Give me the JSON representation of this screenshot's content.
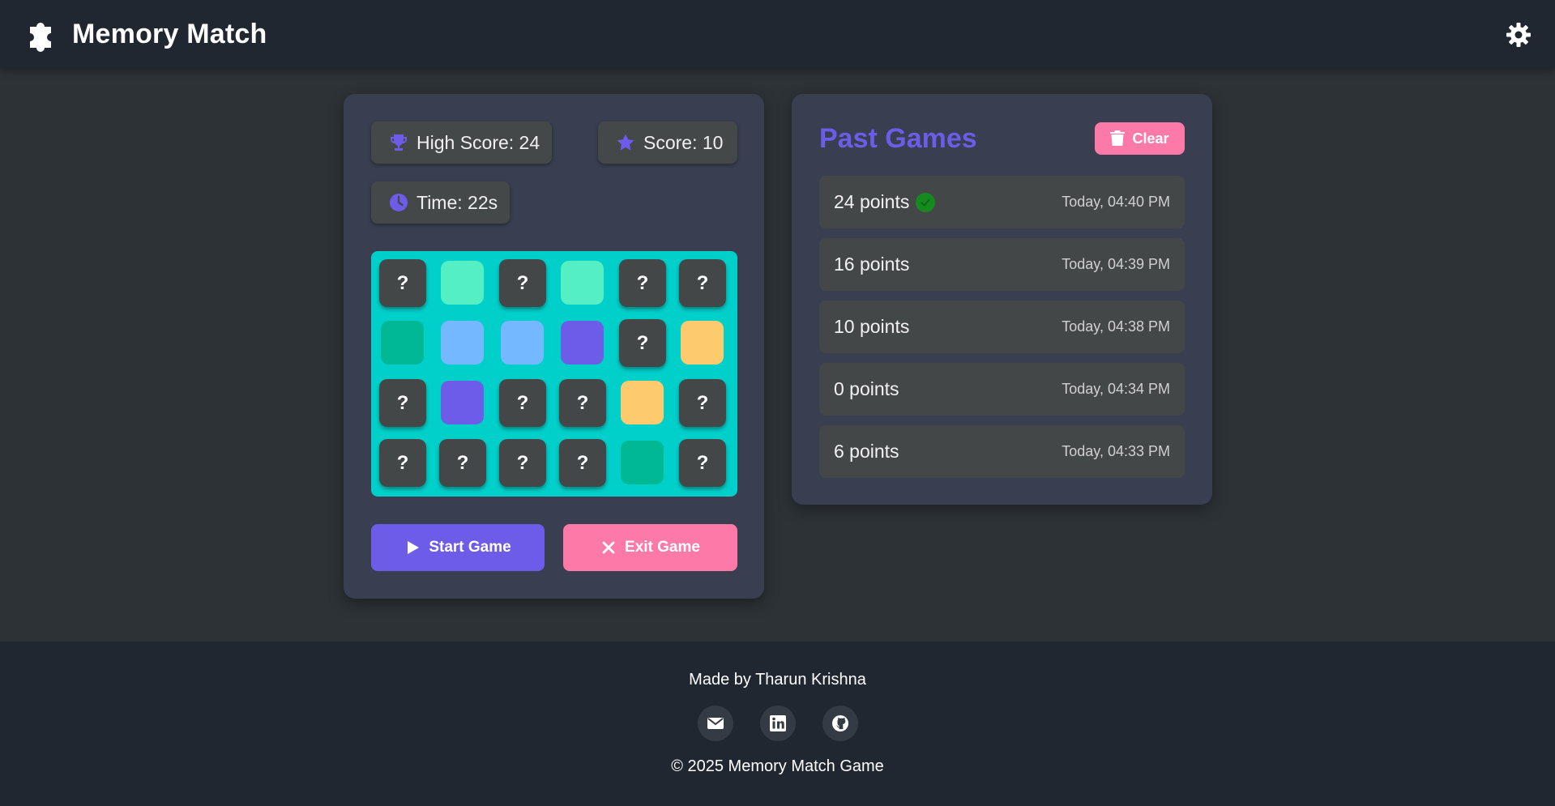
{
  "header": {
    "title": "Memory Match",
    "logo_icon": "puzzle-piece-icon",
    "settings_icon": "gear-icon"
  },
  "stats": {
    "high_score": "High Score: 24",
    "score": "Score: 10",
    "time": "Time: 22s"
  },
  "board": {
    "rows": 4,
    "cols": 6,
    "hidden_symbol": "?",
    "cards": [
      {
        "state": "hidden"
      },
      {
        "state": "revealed",
        "color": "#55efc4"
      },
      {
        "state": "hidden"
      },
      {
        "state": "revealed",
        "color": "#55efc4"
      },
      {
        "state": "hidden"
      },
      {
        "state": "hidden"
      },
      {
        "state": "revealed",
        "color": "#00b894"
      },
      {
        "state": "revealed",
        "color": "#74b9ff"
      },
      {
        "state": "revealed",
        "color": "#74b9ff"
      },
      {
        "state": "revealed",
        "color": "#6c5ce7"
      },
      {
        "state": "hidden"
      },
      {
        "state": "revealed",
        "color": "#fdcb6e"
      },
      {
        "state": "hidden"
      },
      {
        "state": "revealed",
        "color": "#6c5ce7"
      },
      {
        "state": "hidden"
      },
      {
        "state": "hidden"
      },
      {
        "state": "revealed",
        "color": "#fdcb6e"
      },
      {
        "state": "hidden"
      },
      {
        "state": "hidden"
      },
      {
        "state": "hidden"
      },
      {
        "state": "hidden"
      },
      {
        "state": "hidden"
      },
      {
        "state": "revealed",
        "color": "#00b894"
      },
      {
        "state": "hidden"
      }
    ]
  },
  "controls": {
    "start_label": "Start Game",
    "exit_label": "Exit Game"
  },
  "history": {
    "title": "Past Games",
    "clear_label": "Clear",
    "games": [
      {
        "points": "24 points",
        "time": "Today, 04:40 PM",
        "best": true
      },
      {
        "points": "16 points",
        "time": "Today, 04:39 PM",
        "best": false
      },
      {
        "points": "10 points",
        "time": "Today, 04:38 PM",
        "best": false
      },
      {
        "points": "0 points",
        "time": "Today, 04:34 PM",
        "best": false
      },
      {
        "points": "6 points",
        "time": "Today, 04:33 PM",
        "best": false
      }
    ]
  },
  "footer": {
    "credit": "Made by Tharun Krishna",
    "copyright": "© 2025 Memory Match Game",
    "links": [
      "email-icon",
      "linkedin-icon",
      "github-icon"
    ]
  },
  "colors": {
    "accent": "#6c5ce7",
    "danger": "#fd79a8",
    "board_bg": "#00cfca",
    "success": "#158a1f"
  }
}
